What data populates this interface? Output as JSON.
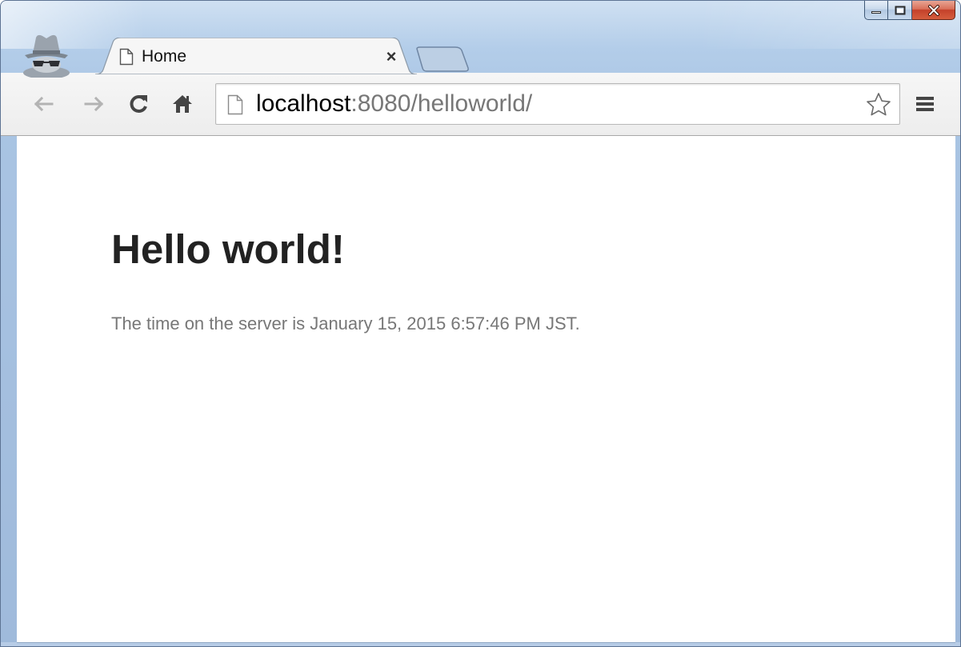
{
  "window": {
    "caption_buttons": {
      "minimize_icon": "minimize-icon",
      "maximize_icon": "maximize-icon",
      "close_icon": "close-icon"
    },
    "incognito_icon": "incognito-icon",
    "accent_colors": {
      "frame": "#a9c4e3",
      "close_button": "#c4412a"
    }
  },
  "tabs": [
    {
      "title": "Home",
      "icon": "page-icon",
      "close_label": "×",
      "active": true
    }
  ],
  "toolbar": {
    "back_icon": "back-arrow-icon",
    "forward_icon": "forward-arrow-icon",
    "reload_icon": "reload-icon",
    "home_icon": "home-icon",
    "menu_icon": "menu-icon"
  },
  "omnibox": {
    "url_host": "localhost",
    "url_rest": ":8080/helloworld/",
    "page_icon": "page-icon",
    "bookmark_icon": "star-icon"
  },
  "page": {
    "heading": "Hello world!",
    "time_text": "The time on the server is January 15, 2015 6:57:46 PM JST."
  }
}
